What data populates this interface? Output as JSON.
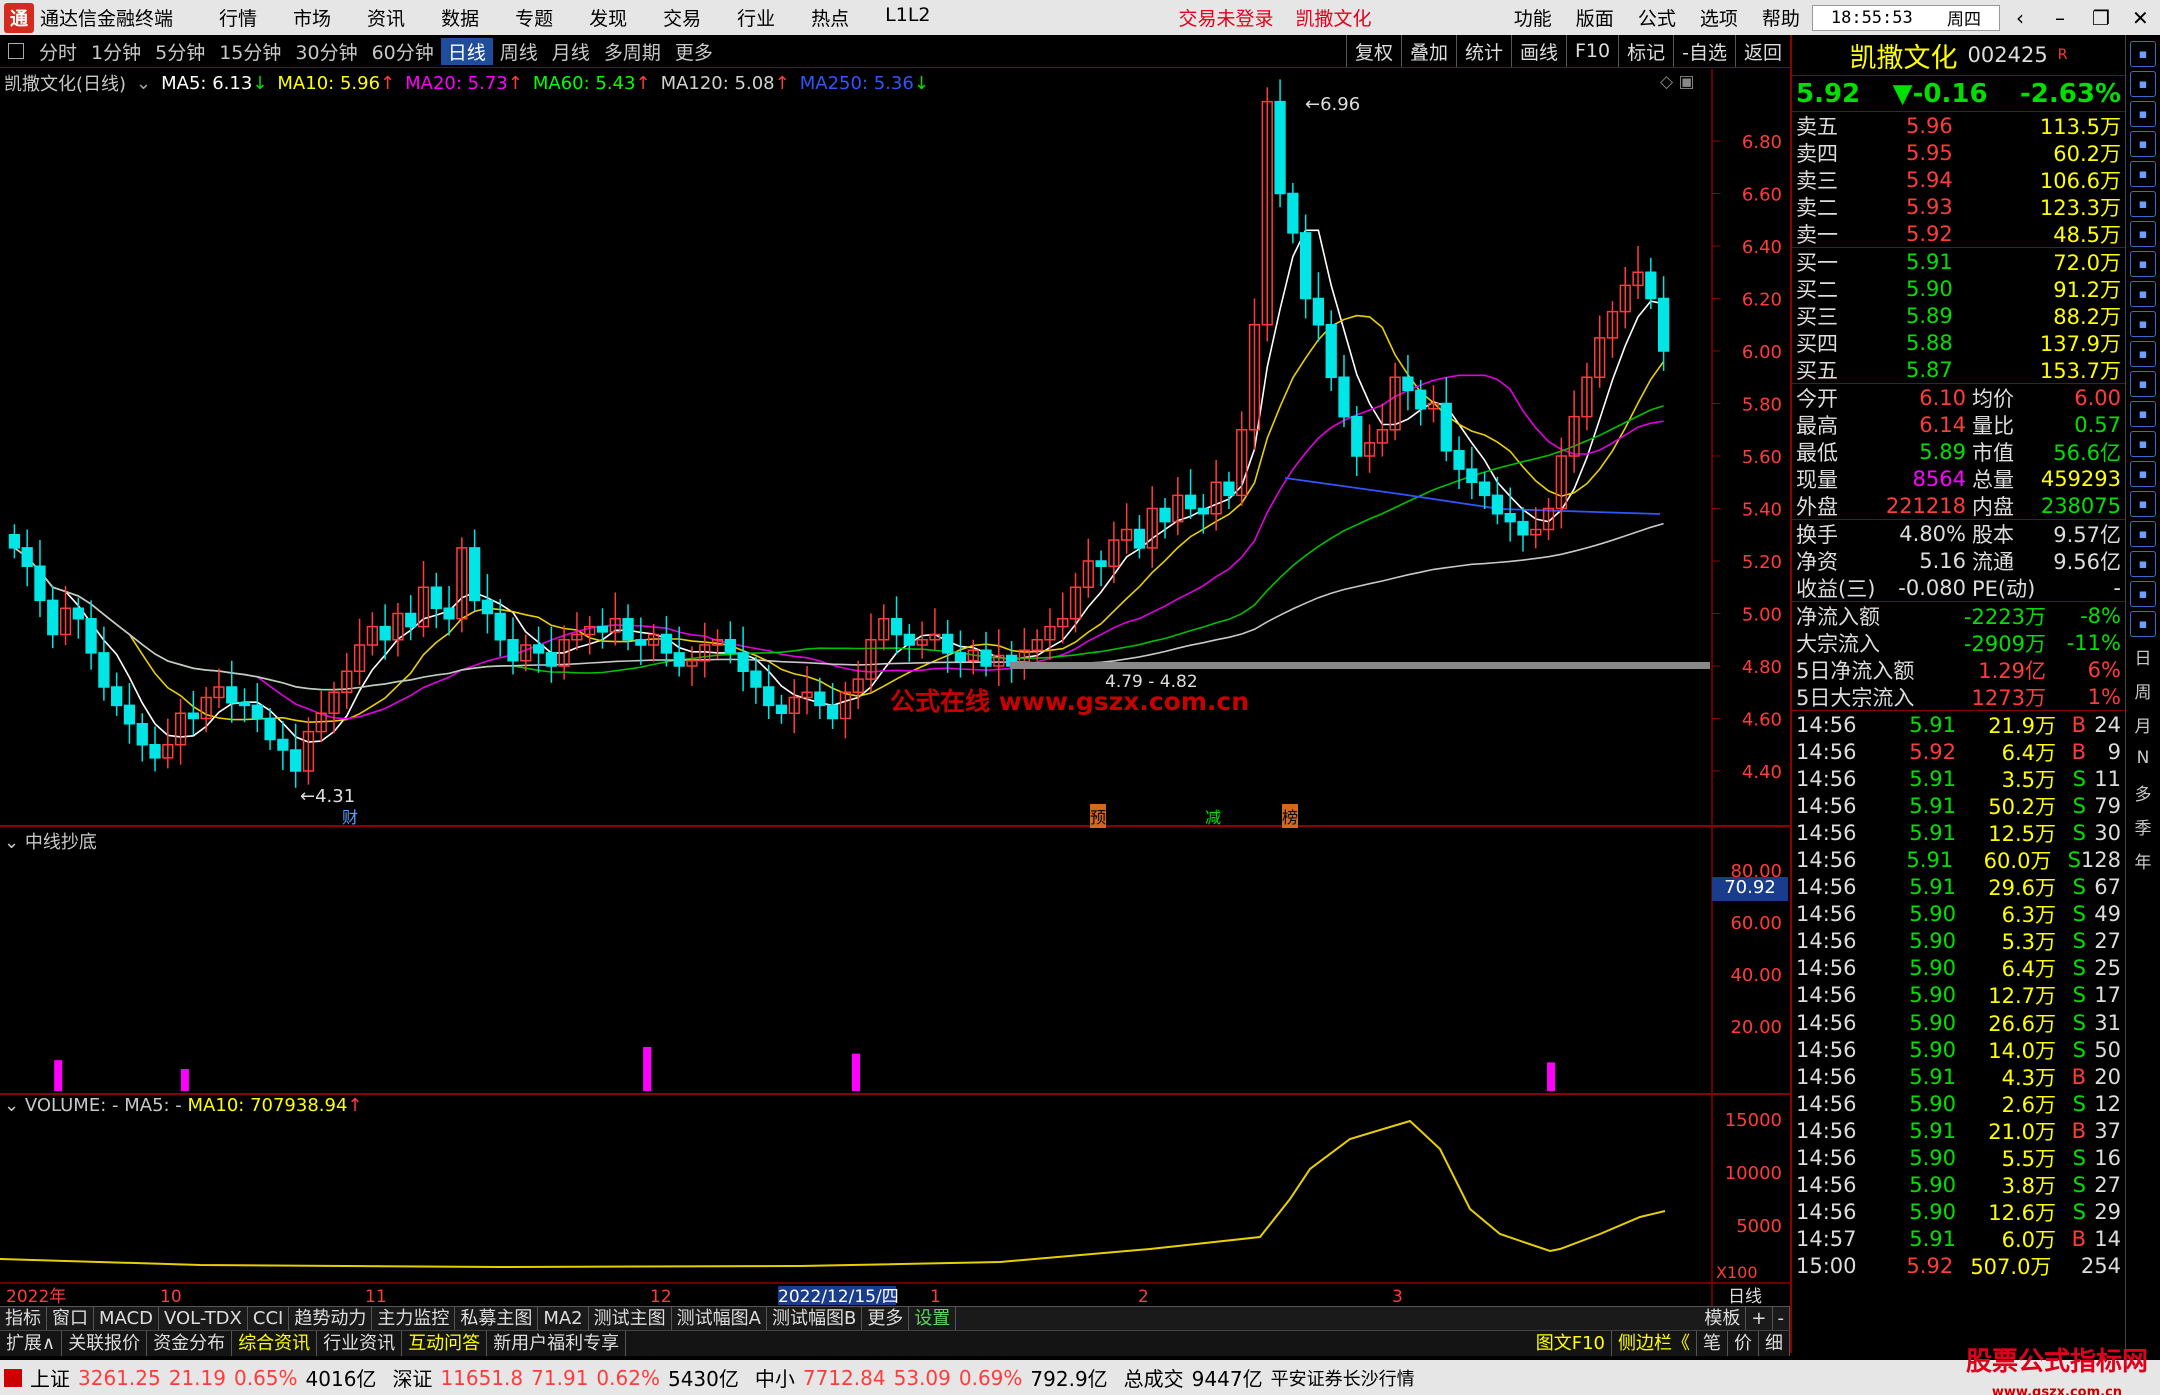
{
  "app": {
    "title": "通达信金融终端",
    "login": "交易未登录",
    "stock_name": "凯撒文化",
    "menus": [
      "行情",
      "市场",
      "资讯",
      "数据",
      "专题",
      "发现",
      "交易",
      "行业",
      "热点",
      "L1L2"
    ],
    "right_menus": [
      "功能",
      "版面",
      "公式",
      "选项",
      "帮助"
    ],
    "clock": "18:55:53",
    "weekday": "周四"
  },
  "periods": [
    "分时",
    "1分钟",
    "5分钟",
    "15分钟",
    "30分钟",
    "60分钟",
    "日线",
    "周线",
    "月线",
    "多周期",
    "更多"
  ],
  "active_period": "日线",
  "chart_tools": [
    "复权",
    "叠加",
    "统计",
    "画线",
    "F10",
    "标记",
    "-自选",
    "返回"
  ],
  "main_legend": {
    "label": "凯撒文化(日线)",
    "ma": [
      {
        "t": "MA5: 6.13",
        "c": "#ffffff",
        "a": "↓"
      },
      {
        "t": "MA10: 5.96",
        "c": "#ffff00",
        "a": "↑"
      },
      {
        "t": "MA20: 5.73",
        "c": "#ff00ff",
        "a": "↑"
      },
      {
        "t": "MA60: 5.43",
        "c": "#00ff00",
        "a": "↑"
      },
      {
        "t": "MA120: 5.08",
        "c": "#d0d0d0",
        "a": "↑"
      },
      {
        "t": "MA250: 5.36",
        "c": "#3355ff",
        "a": "↓"
      }
    ]
  },
  "price_axis": [
    "6.80",
    "6.60",
    "6.40",
    "6.20",
    "6.00",
    "5.80",
    "5.60",
    "5.40",
    "5.20",
    "5.00",
    "4.80",
    "4.60",
    "4.40"
  ],
  "annotations": {
    "high": "6.96",
    "low": "4.31",
    "range": "4.79 - 4.82",
    "watermark": "公式在线 www.gszx.com.cn",
    "markers": [
      "财",
      "预",
      "减",
      "榜"
    ]
  },
  "indicator": {
    "label": "中线抄底",
    "axis": [
      "80.00",
      "60.00",
      "40.00",
      "20.00"
    ],
    "current": "70.92"
  },
  "volume": {
    "label": "VOLUME: -",
    "ma5": "MA5: -",
    "ma10": "MA10: 707938.94",
    "axis": [
      "15000",
      "10000",
      "5000"
    ],
    "unit": "X100"
  },
  "dates": [
    "2022年",
    "10",
    "11",
    "12",
    "2022/12/15/四",
    "1",
    "2",
    "3"
  ],
  "date_mode": "日线",
  "quote": {
    "name": "凯撒文化",
    "code": "002425",
    "price": "5.92",
    "change": "▼-0.16",
    "pct": "-2.63%",
    "asks": [
      [
        "卖五",
        "5.96",
        "113.5万"
      ],
      [
        "卖四",
        "5.95",
        "60.2万"
      ],
      [
        "卖三",
        "5.94",
        "106.6万"
      ],
      [
        "卖二",
        "5.93",
        "123.3万"
      ],
      [
        "卖一",
        "5.92",
        "48.5万"
      ]
    ],
    "bids": [
      [
        "买一",
        "5.91",
        "72.0万"
      ],
      [
        "买二",
        "5.90",
        "91.2万"
      ],
      [
        "买三",
        "5.89",
        "88.2万"
      ],
      [
        "买四",
        "5.88",
        "137.9万"
      ],
      [
        "买五",
        "5.87",
        "153.7万"
      ]
    ],
    "stats": [
      [
        "今开",
        "6.10",
        "均价",
        "6.00"
      ],
      [
        "最高",
        "6.14",
        "量比",
        "0.57"
      ],
      [
        "最低",
        "5.89",
        "市值",
        "56.6亿"
      ],
      [
        "现量",
        "8564",
        "总量",
        "459293"
      ],
      [
        "外盘",
        "221218",
        "内盘",
        "238075"
      ]
    ],
    "stats2": [
      [
        "换手",
        "4.80%",
        "股本",
        "9.57亿"
      ],
      [
        "净资",
        "5.16",
        "流通",
        "9.56亿"
      ],
      [
        "收益(三)",
        "-0.080",
        "PE(动)",
        "-"
      ]
    ],
    "flows": [
      [
        "净流入额",
        "-2223万",
        "-8%"
      ],
      [
        "大宗流入",
        "-2909万",
        "-11%"
      ],
      [
        "5日净流入额",
        "1.29亿",
        "6%"
      ],
      [
        "5日大宗流入",
        "1273万",
        "1%"
      ]
    ],
    "ticks": [
      [
        "14:56",
        "5.91",
        "21.9万",
        "B",
        "24"
      ],
      [
        "14:56",
        "5.92",
        "6.4万",
        "B",
        "9"
      ],
      [
        "14:56",
        "5.91",
        "3.5万",
        "S",
        "11"
      ],
      [
        "14:56",
        "5.91",
        "50.2万",
        "S",
        "79"
      ],
      [
        "14:56",
        "5.91",
        "12.5万",
        "S",
        "30"
      ],
      [
        "14:56",
        "5.91",
        "60.0万",
        "S",
        "128"
      ],
      [
        "14:56",
        "5.91",
        "29.6万",
        "S",
        "67"
      ],
      [
        "14:56",
        "5.90",
        "6.3万",
        "S",
        "49"
      ],
      [
        "14:56",
        "5.90",
        "5.3万",
        "S",
        "27"
      ],
      [
        "14:56",
        "5.90",
        "6.4万",
        "S",
        "25"
      ],
      [
        "14:56",
        "5.90",
        "12.7万",
        "S",
        "17"
      ],
      [
        "14:56",
        "5.90",
        "26.6万",
        "S",
        "31"
      ],
      [
        "14:56",
        "5.90",
        "14.0万",
        "S",
        "50"
      ],
      [
        "14:56",
        "5.91",
        "4.3万",
        "B",
        "20"
      ],
      [
        "14:56",
        "5.90",
        "2.6万",
        "S",
        "12"
      ],
      [
        "14:56",
        "5.91",
        "21.0万",
        "B",
        "37"
      ],
      [
        "14:56",
        "5.90",
        "5.5万",
        "S",
        "16"
      ],
      [
        "14:56",
        "5.90",
        "3.8万",
        "S",
        "27"
      ],
      [
        "14:56",
        "5.90",
        "12.6万",
        "S",
        "29"
      ],
      [
        "14:57",
        "5.91",
        "6.0万",
        "B",
        "14"
      ],
      [
        "15:00",
        "5.92",
        "507.0万",
        "",
        "254"
      ]
    ]
  },
  "tabbar1": [
    "指标",
    "窗口",
    "MACD",
    "VOL-TDX",
    "CCI",
    "趋势动力",
    "主力监控",
    "私募主图",
    "MA2",
    "测试主图",
    "测试幅图A",
    "测试幅图B",
    "更多",
    "设置"
  ],
  "tabbar1_right": [
    "模板",
    "+",
    "-"
  ],
  "tabbar2": [
    "扩展∧",
    "关联报价",
    "资金分布",
    "综合资讯",
    "行业资讯",
    "互动问答",
    "新用户福利专享"
  ],
  "tabbar2_right": [
    "图文F10",
    "侧边栏《",
    "笔",
    "价",
    "细"
  ],
  "sidebar_labels": [
    "日",
    "周",
    "月",
    "N",
    "多",
    "季",
    "年"
  ],
  "status": {
    "sh_name": "上证",
    "sh": "3261.25",
    "sh_chg": "21.19",
    "sh_pct": "0.65%",
    "sh_amt": "4016亿",
    "sz_name": "深证",
    "sz": "11651.8",
    "sz_chg": "71.91",
    "sz_pct": "0.62%",
    "sz_amt": "5430亿",
    "zx_name": "中小",
    "zx": "7712.84",
    "zx_chg": "53.09",
    "zx_pct": "0.69%",
    "zx_amt": "792.9亿",
    "total_label": "总成交",
    "total": "9447亿",
    "broker": "平安证券长沙行情",
    "brand": "股票公式指标网",
    "brand_url": "www.gszx.com.cn"
  },
  "chart_data": {
    "type": "candlestick",
    "ylim": [
      4.31,
      6.96
    ],
    "indicator_bars": [
      {
        "x": 0.034,
        "v": 14
      },
      {
        "x": 0.108,
        "v": 10
      },
      {
        "x": 0.378,
        "v": 20
      },
      {
        "x": 0.5,
        "v": 17
      },
      {
        "x": 0.906,
        "v": 13
      }
    ]
  }
}
